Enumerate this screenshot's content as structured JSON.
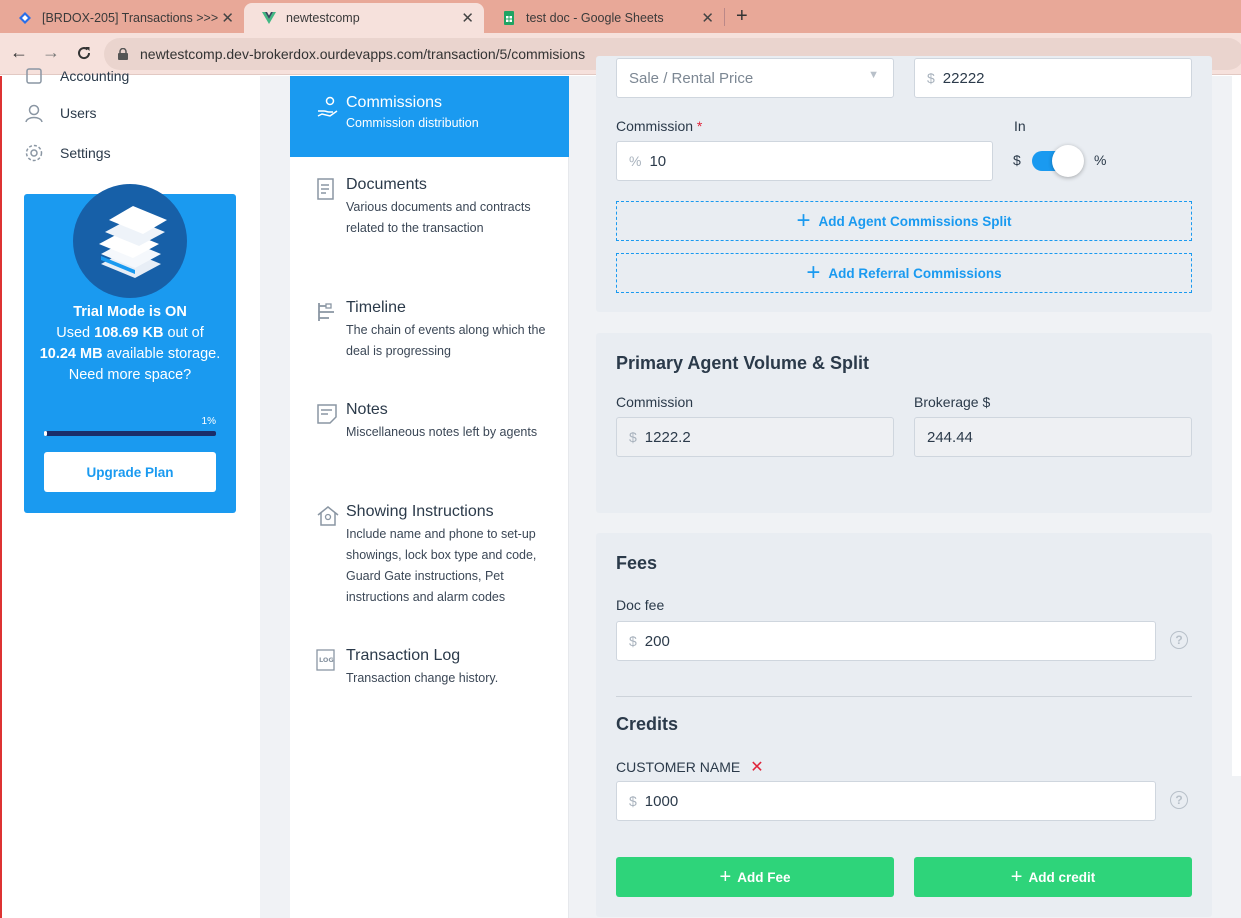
{
  "browser": {
    "tabs": [
      {
        "title": "[BRDOX-205] Transactions >>>"
      },
      {
        "title": "newtestcomp"
      },
      {
        "title": "test doc - Google Sheets"
      }
    ],
    "url": "newtestcomp.dev-brokerdox.ourdevapps.com/transaction/5/commisions"
  },
  "sidebar": {
    "items": [
      {
        "label": "Accounting"
      },
      {
        "label": "Users"
      },
      {
        "label": "Settings"
      }
    ],
    "trial": {
      "line1": "Trial Mode is ON",
      "used_prefix": "Used",
      "used_value": "108.69 KB",
      "used_mid": "out of",
      "total_value": "10.24 MB",
      "total_suffix": "available storage.",
      "question": "Need more space?",
      "percent_label": "1%",
      "percent": 1,
      "upgrade_label": "Upgrade Plan"
    }
  },
  "sections": [
    {
      "title": "Commissions",
      "desc": "Commission distribution"
    },
    {
      "title": "Documents",
      "desc": "Various documents and contracts related to the transaction"
    },
    {
      "title": "Timeline",
      "desc": "The chain of events along which the deal is progressing"
    },
    {
      "title": "Notes",
      "desc": "Miscellaneous notes left by agents"
    },
    {
      "title": "Showing Instructions",
      "desc": "Include name and phone to set-up showings, lock box type and code, Guard Gate instructions, Pet instructions and alarm codes"
    },
    {
      "title": "Transaction Log",
      "desc": "Transaction change history."
    }
  ],
  "commission_form": {
    "price_select_value": "Sale / Rental Price",
    "price_prefix": "$",
    "price_value": "22222",
    "commission_label": "Commission",
    "required_mark": "*",
    "commission_prefix": "%",
    "commission_value": "10",
    "in_label": "In",
    "toggle_left": "$",
    "toggle_right": "%",
    "add_agent_split": "Add Agent Commissions Split",
    "add_referral": "Add Referral Commissions"
  },
  "primary_agent": {
    "title": "Primary Agent Volume & Split",
    "commission_label": "Commission",
    "commission_prefix": "$",
    "commission_value": "1222.2",
    "brokerage_label": "Brokerage $",
    "brokerage_value": "244.44"
  },
  "fees": {
    "title": "Fees",
    "doc_fee_label": "Doc fee",
    "doc_fee_prefix": "$",
    "doc_fee_value": "200",
    "credits_title": "Credits",
    "customer_label": "CUSTOMER NAME",
    "customer_prefix": "$",
    "customer_value": "1000",
    "help_glyph": "?",
    "add_fee": "Add Fee",
    "add_credit": "Add credit"
  },
  "colors": {
    "primary": "#1a9af0",
    "green": "#2ed47a",
    "danger": "#e0243a"
  }
}
